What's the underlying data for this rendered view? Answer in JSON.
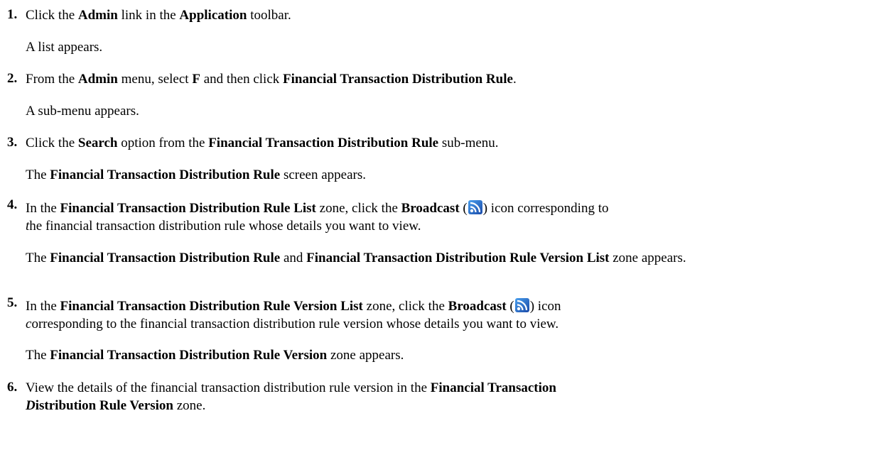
{
  "steps": [
    {
      "number": "1.",
      "instruction": {
        "t1": "Click the ",
        "b1": "Admin",
        "t2": " link in the ",
        "b2": "Application",
        "t3": " toolbar."
      },
      "result": {
        "t1": "A list appears."
      }
    },
    {
      "number": "2.",
      "instruction": {
        "t1": "From the ",
        "b1": "Admin",
        "t2": " menu, select ",
        "b2": "F",
        "t3": " and then click ",
        "b3": "Financial Transaction Distribution Rule",
        "t4": "."
      },
      "result": {
        "t1": "A sub-menu appears."
      }
    },
    {
      "number": "3.",
      "instruction": {
        "t1": "Click the ",
        "b1": "Search",
        "t2": " option from the ",
        "b2": "Financial Transaction Distribution Rule",
        "t3": " sub-menu."
      },
      "result": {
        "t1": "The ",
        "b1": "Financial Transaction Distribution Rule",
        "t2": " screen appears."
      }
    },
    {
      "number": "4.",
      "instruction": {
        "t1": "In the ",
        "b1": "Financial Transaction Distribution Rule List",
        "t2": " zone, click the ",
        "b2": "Broadcast",
        "t3": " (",
        "icon": "broadcast-icon",
        "t4": ") icon corresponding to",
        "i1": "t",
        "t5": "he financial transaction distribution rule whose details you want to view."
      },
      "result": {
        "t1": "The ",
        "b1": "Financial Transaction Distribution Rule",
        "t2": " and ",
        "b2": "Financial Transaction Distribution Rule Version List",
        "t3": " zone appears."
      }
    },
    {
      "number": "5.",
      "instruction": {
        "t1": "In the ",
        "b1": "Financial Transaction Distribution Rule Version List",
        "t2": " zone, click the ",
        "b2": "Broadcast",
        "t3": " (",
        "icon": "broadcast-icon",
        "t4": ") icon",
        "i1": "c",
        "t5": "orresponding to the financial transaction distribution rule version whose details you want to view."
      },
      "result": {
        "t1": "The ",
        "b1": "Financial Transaction Distribution Rule Version",
        "t2": " zone appears."
      }
    },
    {
      "number": "6.",
      "instruction": {
        "t1": "View the details of the financial transaction distribution rule version in the ",
        "b1": "Financial Transaction",
        "bi1": "D",
        "b2": "istribution Rule Version",
        "t2": " zone."
      }
    }
  ],
  "icon_colors": {
    "broadcast_dark": "#1a4aa8",
    "broadcast_light": "#3f8fe0"
  }
}
